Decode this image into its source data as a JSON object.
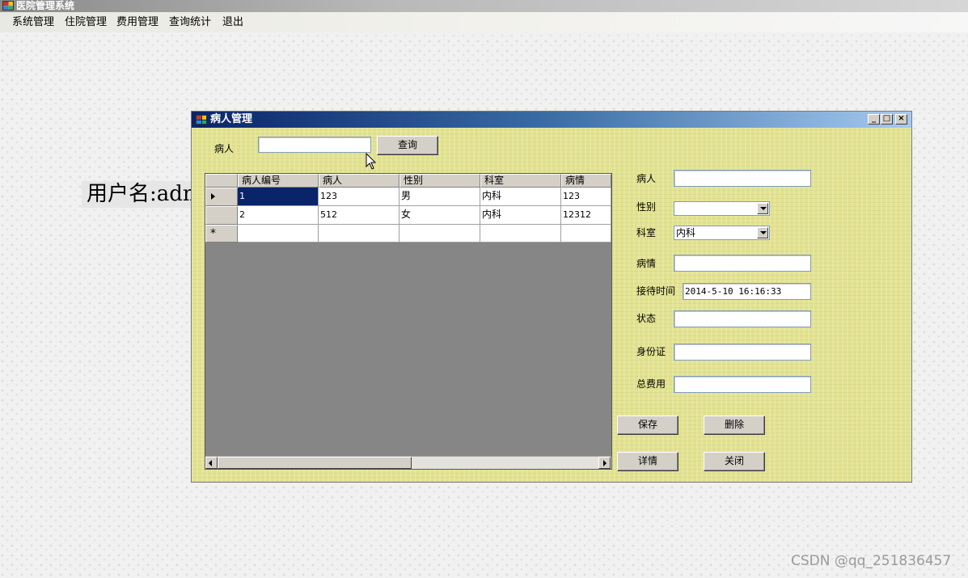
{
  "app": {
    "title": "医院管理系统",
    "menu": [
      "系统管理",
      "住院管理",
      "费用管理",
      "查询统计",
      "退出"
    ],
    "user_label": "用户名:admin"
  },
  "dialog": {
    "title": "病人管理",
    "caption_buttons": [
      "_",
      "□",
      "×"
    ],
    "search": {
      "label": "病人",
      "value": "",
      "button": "查询"
    },
    "grid": {
      "columns": [
        "病人编号",
        "病人",
        "性别",
        "科室",
        "病情"
      ],
      "rows": [
        [
          "1",
          "123",
          "男",
          "内科",
          "123"
        ],
        [
          "2",
          "512",
          "女",
          "内科",
          "12312"
        ]
      ],
      "new_row_marker": "*",
      "current_row_marker": "▶"
    },
    "form": {
      "patient_label": "病人",
      "patient_value": "",
      "gender_label": "性别",
      "gender_value": "",
      "dept_label": "科室",
      "dept_value": "内科",
      "condition_label": "病情",
      "condition_value": "",
      "time_label": "接待时间",
      "time_value": "2014-5-10 16:16:33",
      "status_label": "状态",
      "status_value": "",
      "id_label": "身份证",
      "id_value": "",
      "fee_label": "总费用",
      "fee_value": ""
    },
    "buttons": {
      "save": "保存",
      "delete": "删除",
      "detail": "详情",
      "close": "关闭"
    }
  },
  "watermark": "CSDN @qq_251836457",
  "colors": {
    "dialog_bg": "#e2e290",
    "titlebar": "#0a246a",
    "selection": "#0a246a"
  }
}
